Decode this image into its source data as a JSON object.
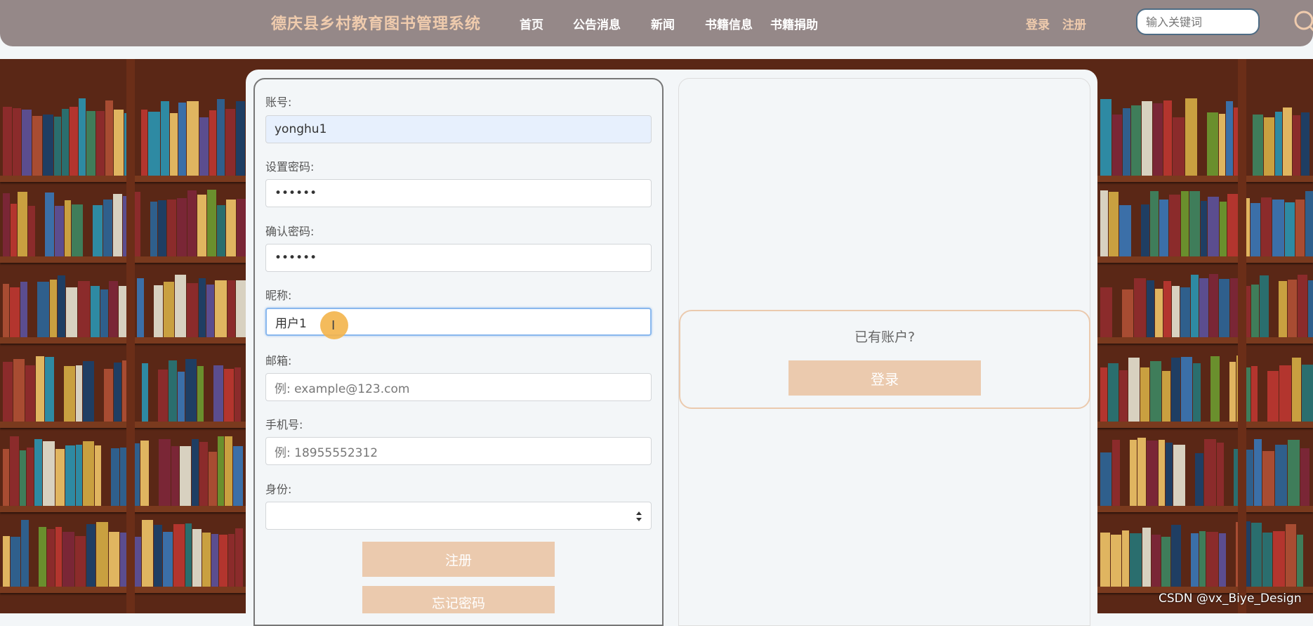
{
  "header": {
    "site_title": "德庆县乡村教育图书管理系统",
    "nav": [
      "首页",
      "公告消息",
      "新闻",
      "书籍信息",
      "书籍捐助"
    ],
    "login_link": "登录",
    "register_link": "注册",
    "search_placeholder": "输入关键词"
  },
  "form": {
    "account_label": "账号:",
    "account_value": "yonghu1",
    "password_label": "设置密码:",
    "password_value": "••••••",
    "confirm_label": "确认密码:",
    "confirm_value": "••••••",
    "nickname_label": "昵称:",
    "nickname_value": "用户1",
    "email_label": "邮箱:",
    "email_placeholder": "例: example@123.com",
    "phone_label": "手机号:",
    "phone_placeholder": "例: 18955552312",
    "role_label": "身份:",
    "role_value": "",
    "register_button": "注册",
    "forgot_button": "忘记密码"
  },
  "side": {
    "have_account": "已有账户?",
    "login_button": "登录"
  },
  "watermark": "CSDN @vx_Biye_Design",
  "colors": {
    "header_bg": "#958888",
    "accent": "#ebcaae",
    "title": "#efcbad"
  }
}
